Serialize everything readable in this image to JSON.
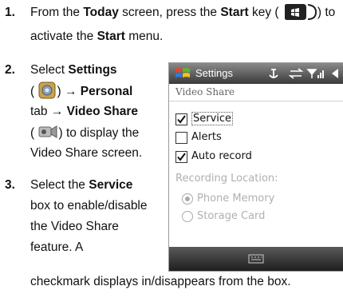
{
  "steps": [
    {
      "number": "1.",
      "lines": [
        {
          "t1": "From the ",
          "b1": "Today",
          "t2": " screen, press the ",
          "b2": "Start",
          "t3": " key (",
          "t4": ") to"
        },
        {
          "t1": "activate the ",
          "b1": "Start",
          "t2": " menu."
        }
      ]
    },
    {
      "number": "2.",
      "lines": [
        {
          "t1": "Select ",
          "b1": "Settings"
        },
        {
          "t1": "(",
          "b1": "→ Personal",
          "t2": ")"
        },
        {
          "b1": "tab → ",
          "b2": "Video Share"
        },
        {
          "t1": "(",
          "t2": ") to display the"
        },
        {
          "t1": "Video Share screen."
        }
      ]
    },
    {
      "number": "3.",
      "lines": [
        {
          "t1": "Select the ",
          "b1": "Service"
        },
        {
          "t1": "box to enable/disable"
        },
        {
          "t1": "the Video Share"
        },
        {
          "t1": "feature. A"
        }
      ]
    }
  ],
  "continuation": "checkmark displays in/disappears from the box.",
  "phone": {
    "title": "Settings",
    "subtitle": "Video Share",
    "checkboxes": [
      {
        "label": "Service",
        "checked": true
      },
      {
        "label": "Alerts",
        "checked": false
      },
      {
        "label": "Auto record",
        "checked": true
      }
    ],
    "recording_label": "Recording Location:",
    "radios": [
      {
        "label": "Phone Memory",
        "selected": true
      },
      {
        "label": "Storage Card",
        "selected": false
      }
    ]
  },
  "icons": [
    "start-key-icon",
    "settings-icon",
    "video-share-icon",
    "windows-logo-icon",
    "keyboard-icon"
  ]
}
